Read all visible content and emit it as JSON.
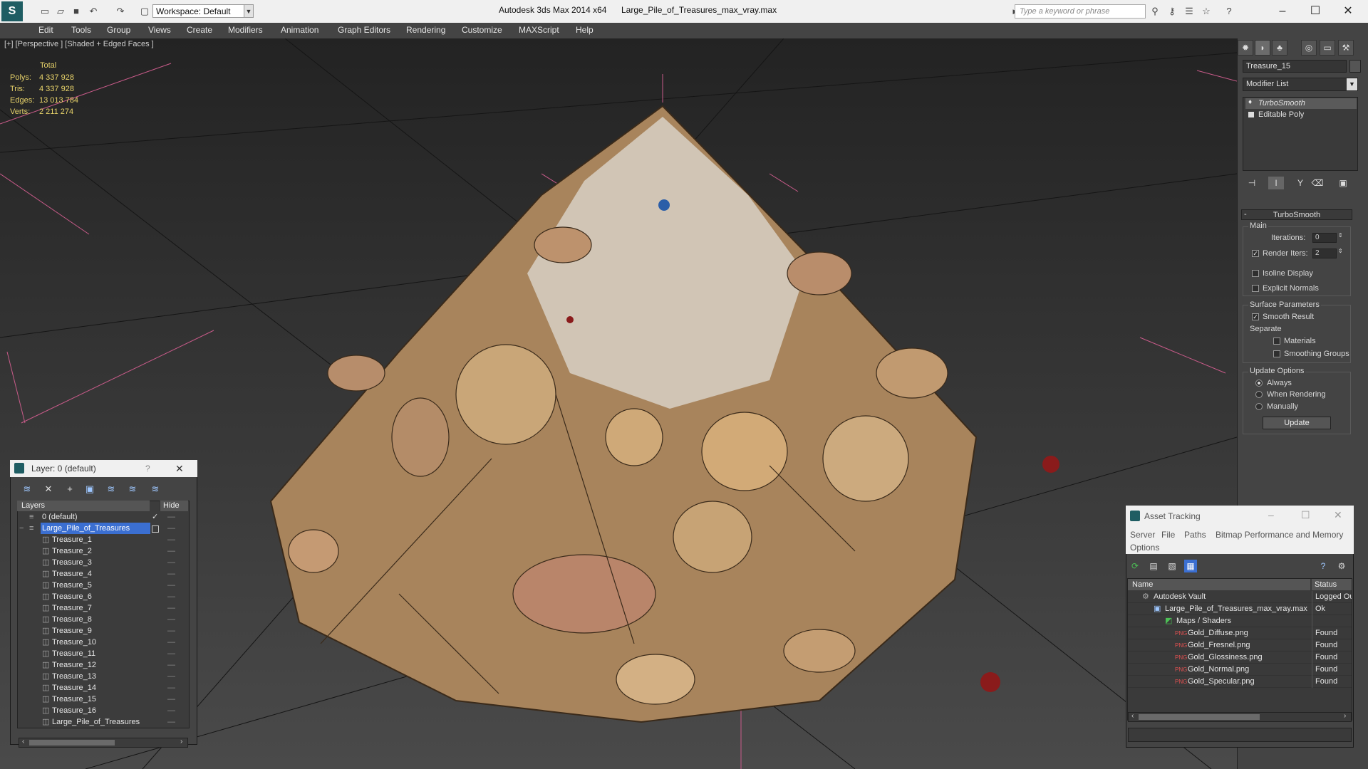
{
  "titlebar": {
    "workspace": "Workspace: Default",
    "app_title": "Autodesk 3ds Max  2014 x64",
    "file_name": "Large_Pile_of_Treasures_max_vray.max",
    "search_placeholder": "Type a keyword or phrase"
  },
  "menu": [
    "Edit",
    "Tools",
    "Group",
    "Views",
    "Create",
    "Modifiers",
    "Animation",
    "Graph Editors",
    "Rendering",
    "Customize",
    "MAXScript",
    "Help"
  ],
  "viewport": {
    "label": "[+] [Perspective ] [Shaded + Edged Faces ]",
    "stats_header": "Total",
    "stats": [
      {
        "label": "Polys:",
        "value": "4 337 928"
      },
      {
        "label": "Tris:",
        "value": "4 337 928"
      },
      {
        "label": "Edges:",
        "value": "13 013 784"
      },
      {
        "label": "Verts:",
        "value": "2 211 274"
      }
    ]
  },
  "command_panel": {
    "object_name": "Treasure_15",
    "modifier_list": "Modifier List",
    "stack": [
      "TurboSmooth",
      "Editable Poly"
    ],
    "rollout_title": "TurboSmooth",
    "main_group": "Main",
    "iterations_label": "Iterations:",
    "iterations_value": "0",
    "render_iters_label": "Render Iters:",
    "render_iters_value": "2",
    "isoline": "Isoline Display",
    "explicit_normals": "Explicit Normals",
    "surface_group": "Surface Parameters",
    "smooth_result": "Smooth Result",
    "separate": "Separate",
    "materials": "Materials",
    "smoothing_groups": "Smoothing Groups",
    "update_group": "Update Options",
    "always": "Always",
    "when_rendering": "When Rendering",
    "manually": "Manually",
    "update_button": "Update"
  },
  "layer_dialog": {
    "title": "Layer: 0 (default)",
    "help": "?",
    "col_layers": "Layers",
    "col_hide": "Hide",
    "layers": [
      "0 (default)",
      "Large_Pile_of_Treasures",
      "Treasure_1",
      "Treasure_2",
      "Treasure_3",
      "Treasure_4",
      "Treasure_5",
      "Treasure_6",
      "Treasure_7",
      "Treasure_8",
      "Treasure_9",
      "Treasure_10",
      "Treasure_11",
      "Treasure_12",
      "Treasure_13",
      "Treasure_14",
      "Treasure_15",
      "Treasure_16",
      "Large_Pile_of_Treasures"
    ]
  },
  "asset_tracking": {
    "title": "Asset Tracking",
    "menu": [
      "Server",
      "File",
      "Paths",
      "Bitmap Performance and Memory",
      "Options"
    ],
    "col_name": "Name",
    "col_status": "Status",
    "rows": [
      {
        "name": "Autodesk Vault",
        "status": "Logged Out"
      },
      {
        "name": "Large_Pile_of_Treasures_max_vray.max",
        "status": "Ok"
      },
      {
        "name": "Maps / Shaders",
        "status": ""
      },
      {
        "name": "Gold_Diffuse.png",
        "status": "Found"
      },
      {
        "name": "Gold_Fresnel.png",
        "status": "Found"
      },
      {
        "name": "Gold_Glossiness.png",
        "status": "Found"
      },
      {
        "name": "Gold_Normal.png",
        "status": "Found"
      },
      {
        "name": "Gold_Specular.png",
        "status": "Found"
      }
    ]
  }
}
